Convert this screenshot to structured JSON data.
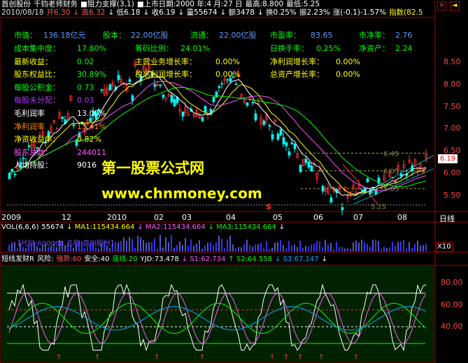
{
  "header": {
    "row1": [
      {
        "text": "首创股份",
        "color": "#ffffff"
      },
      {
        "text": "千钧老师财务",
        "color": "#ffffff"
      },
      {
        "text": "■阻力支撑(3,1)",
        "color": "#ffffff"
      },
      {
        "text": "■上市日期:2000 年:4 月:27 日",
        "color": "#ffffff"
      },
      {
        "text": "最高:8.800",
        "color": "#ffffff"
      },
      {
        "text": "最低:5.25",
        "color": "#ffffff"
      }
    ],
    "row2": [
      {
        "text": "2010/08/18",
        "color": "#dddddd"
      },
      {
        "text": "开6.30",
        "color": "#ff5555"
      },
      {
        "text": "↓ 高6.32",
        "color": "#ff5555"
      },
      {
        "text": "↓ 低6.18",
        "color": "#ffffff"
      },
      {
        "text": "↓ 收6.19",
        "color": "#ffffff"
      },
      {
        "text": "↓ 量55674",
        "color": "#ffffff"
      },
      {
        "text": "↓ 额3478",
        "color": "#ffffff"
      },
      {
        "text": "↓ 换0.25%",
        "color": "#ffffff"
      },
      {
        "text": "振2.23%",
        "color": "#ffffff"
      },
      {
        "text": "涨(-0.1)-1.57%",
        "color": "#ffffff"
      },
      {
        "text": "指数(82.5",
        "color": "#ffff00"
      }
    ],
    "window_icons": [
      "×"
    ]
  },
  "info_panel": {
    "row_market": [
      {
        "label": "市值：",
        "value": "136.18亿元"
      },
      {
        "label": "股本：",
        "value": "22.00亿股"
      },
      {
        "label": "流通：",
        "value": "22.00亿股"
      },
      {
        "label": "市盈率：",
        "value": "83.65"
      },
      {
        "label": "市净率：",
        "value": "2.76"
      }
    ],
    "left": [
      {
        "label": "成本集中度：",
        "value": "17.80%",
        "label_color": "#00ff00",
        "value_color": "#00ff00"
      },
      {
        "label": "最新收益：",
        "value": "0.02",
        "label_color": "#ffff00",
        "value_color": "#00ff00"
      },
      {
        "label": "股东权益比：",
        "value": "30.89%",
        "label_color": "#ffff00",
        "value_color": "#00ff00"
      },
      {
        "label": "每股公积金：",
        "value": "0.73",
        "label_color": "#00ff00",
        "value_color": "#00ff00"
      },
      {
        "label": "每股未分配：",
        "value": "0.03",
        "label_color": "#aa33ff",
        "value_color": "#aa33ff"
      },
      {
        "label": "毛利润率",
        "value": "13.00%",
        "label_color": "#ffffff",
        "value_color": "#ffffff"
      },
      {
        "label": "净利润率",
        "value": "13.41%",
        "label_color": "#ff8800",
        "value_color": "#ff8800"
      },
      {
        "label": "净资收益率：",
        "value": "0.82%",
        "label_color": "#ffff00",
        "value_color": "#ffff00"
      },
      {
        "label": "股东总数：",
        "value": "244011",
        "label_color": "#ff55ff",
        "value_color": "#ff55ff"
      },
      {
        "label": "人均持股：",
        "value": "9016",
        "label_color": "#ffffff",
        "value_color": "#ffffff"
      }
    ],
    "mid": [
      {
        "label": "筹码比例：",
        "value": "24.01%",
        "label_color": "#00ff00",
        "value_color": "#00ff00"
      },
      {
        "label": "主营业务增长率：",
        "value": "0.00%",
        "label_color": "#ffff00",
        "value_color": "#ffff00"
      },
      {
        "label": "税后利润增长率：",
        "value": "0.00%",
        "label_color": "#ffff00",
        "value_color": "#ffff00"
      }
    ],
    "right": [
      {
        "label": "日换手率：",
        "value": "0.25%",
        "label_color": "#00ff00",
        "value_color": "#00ff00"
      },
      {
        "label": "净利润增长率：",
        "value": "0.00%",
        "label_color": "#ffff00",
        "value_color": "#ffff00"
      },
      {
        "label": "总资产增长率：",
        "value": "0.00%",
        "label_color": "#ffff00",
        "value_color": "#ffff00"
      }
    ],
    "right2": [
      {
        "label": "净资产：",
        "value": "2.24",
        "label_color": "#00ff00",
        "value_color": "#00ff00"
      }
    ]
  },
  "watermark": {
    "line1": "第一股票公式网",
    "line2": "www.chnmoney.com"
  },
  "price_axis": {
    "ticks": [
      "8.50",
      "8.00",
      "7.50",
      "7.00",
      "6.50",
      "6.00",
      "5.50"
    ],
    "current": "6.19"
  },
  "chart_annotations": {
    "level_labels": [
      "6.45",
      "6.05",
      "5.65",
      "5.25"
    ],
    "marker": "S"
  },
  "date_axis": [
    "2009",
    "12",
    "2010",
    "02",
    "03",
    "04",
    "05",
    "06",
    "07",
    "08"
  ],
  "period_label": "日线",
  "volume": {
    "title": "VOL(6,6,6)",
    "items": [
      {
        "text": "55674",
        "color": "#ffffff"
      },
      {
        "text": "↓ MA1:115434.664",
        "color": "#ffff00"
      },
      {
        "text": "↓ MA2:115434.664",
        "color": "#ff55ff"
      },
      {
        "text": "↓ MA3:115434.664",
        "color": "#00ff00"
      },
      {
        "text": "↓",
        "color": "#ffffff"
      }
    ],
    "stock_code_text": "【代码:600008  名称:首创股份】",
    "scale": "X10"
  },
  "indicator": {
    "title": "短线发财R",
    "items": [
      {
        "text": "风险:",
        "color": "#ffffff"
      },
      {
        "text": "强势:60",
        "color": "#ff5555"
      },
      {
        "text": "安全:40",
        "color": "#ffffff"
      },
      {
        "text": "底线:20",
        "color": "#00ff00"
      },
      {
        "text": "YJD:73.478",
        "color": "#ffffff"
      },
      {
        "text": "↓ S1:62.734",
        "color": "#ff55ff"
      },
      {
        "text": "↑ S2:64.558",
        "color": "#00ff00"
      },
      {
        "text": "↓ S3:67.147",
        "color": "#00aaff"
      },
      {
        "text": "↓",
        "color": "#ffffff"
      }
    ],
    "ticks": [
      "80.00",
      "60.00",
      "40.00"
    ]
  },
  "colors": {
    "up": "#ff3333",
    "down": "#00ffff",
    "grid": "#aa0000",
    "axis": "#aa0000",
    "indicator_bg": "#002400"
  }
}
